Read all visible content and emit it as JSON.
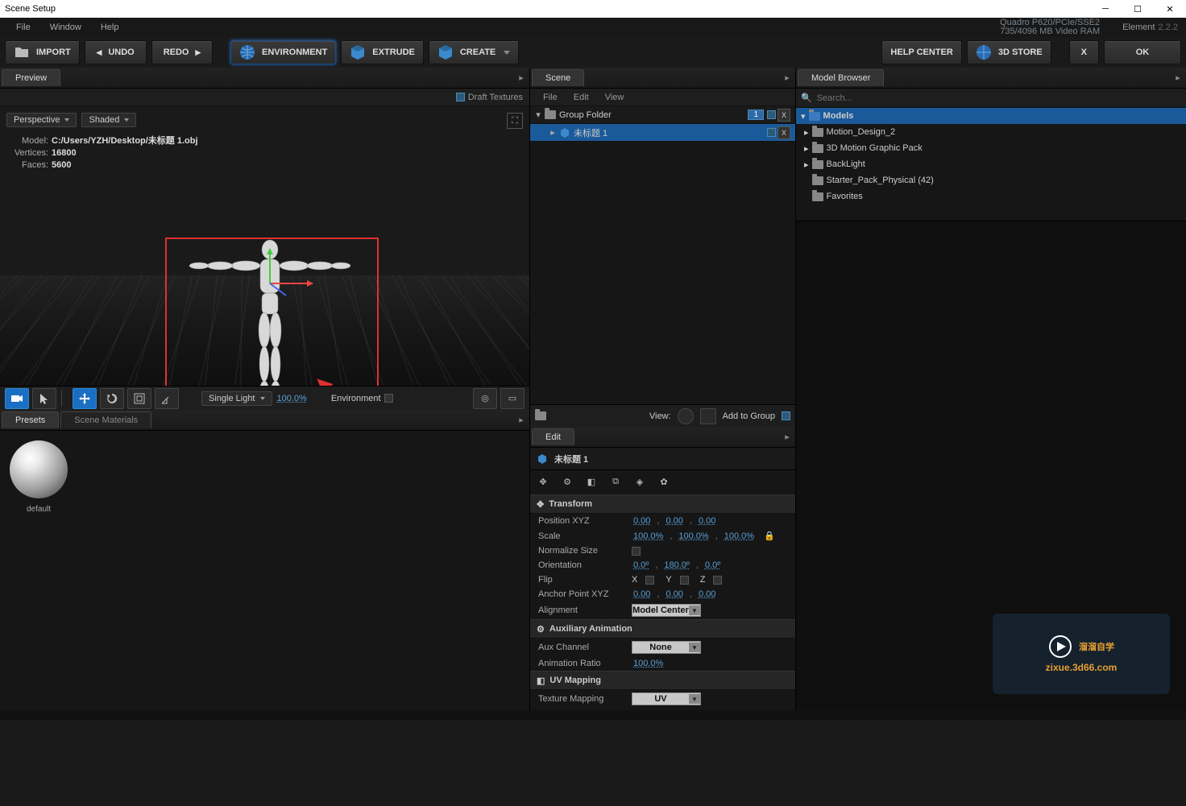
{
  "window": {
    "title": "Scene Setup"
  },
  "menus": {
    "file": "File",
    "window": "Window",
    "help": "Help"
  },
  "gpu": {
    "line1": "Quadro P620/PCIe/SSE2",
    "line2": "735/4096 MB Video RAM"
  },
  "app": {
    "name": "Element",
    "version": "2.2.2"
  },
  "toolbar": {
    "import": "IMPORT",
    "undo": "UNDO",
    "redo": "REDO",
    "environment": "ENVIRONMENT",
    "extrude": "EXTRUDE",
    "create": "CREATE",
    "help_center": "HELP CENTER",
    "store": "3D STORE",
    "x": "X",
    "ok": "OK"
  },
  "preview": {
    "tab": "Preview",
    "draft_textures": "Draft Textures",
    "view_mode": "Perspective",
    "shade_mode": "Shaded",
    "info": {
      "model_label": "Model:",
      "model_path": "C:/Users/YZH/Desktop/未标题 1.obj",
      "vertices_label": "Vertices:",
      "vertices": "16800",
      "faces_label": "Faces:",
      "faces": "5600"
    },
    "light_mode": "Single Light",
    "light_pct": "100.0%",
    "environment_label": "Environment"
  },
  "presets": {
    "tab_presets": "Presets",
    "tab_scene_materials": "Scene Materials",
    "default_material": "default"
  },
  "scene": {
    "tab": "Scene",
    "menus": {
      "file": "File",
      "edit": "Edit",
      "view": "View"
    },
    "group_folder": "Group Folder",
    "group_count": "1",
    "item1": "未标题 1",
    "view_label": "View:",
    "add_to_group": "Add to Group"
  },
  "edit": {
    "tab": "Edit",
    "object_name": "未标题 1",
    "transform": {
      "header": "Transform",
      "position_label": "Position XYZ",
      "pos": [
        "0.00",
        "0.00",
        "0.00"
      ],
      "scale_label": "Scale",
      "scale": [
        "100.0%",
        "100.0%",
        "100.0%"
      ],
      "normalize_label": "Normalize Size",
      "orientation_label": "Orientation",
      "orient": [
        "0.0º",
        "180.0º",
        "0.0º"
      ],
      "flip_label": "Flip",
      "flip_x": "X",
      "flip_y": "Y",
      "flip_z": "Z",
      "anchor_label": "Anchor Point XYZ",
      "anchor": [
        "0.00",
        "0.00",
        "0.00"
      ],
      "alignment_label": "Alignment",
      "alignment_value": "Model Center"
    },
    "aux": {
      "header": "Auxiliary Animation",
      "channel_label": "Aux Channel",
      "channel_value": "None",
      "ratio_label": "Animation Ratio",
      "ratio_value": "100.0%"
    },
    "uv": {
      "header": "UV Mapping",
      "mapping_label": "Texture Mapping",
      "mapping_value": "UV"
    }
  },
  "model_browser": {
    "tab": "Model Browser",
    "search_placeholder": "Search...",
    "root": "Models",
    "items": [
      "Motion_Design_2",
      "3D Motion Graphic Pack",
      "BackLight",
      "Starter_Pack_Physical (42)",
      "Favorites"
    ]
  },
  "watermark": {
    "brand": "溜溜自学",
    "url": "zixue.3d66.com"
  }
}
